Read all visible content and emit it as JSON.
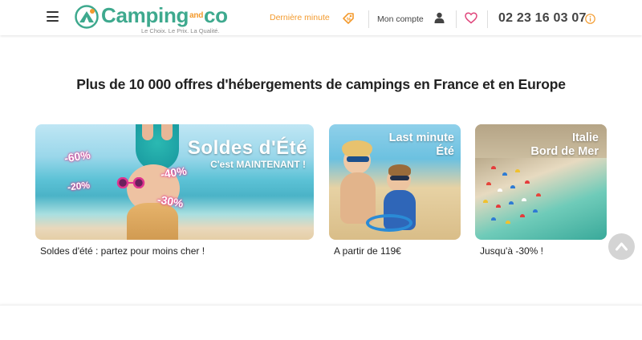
{
  "header": {
    "menu_icon": "hamburger-icon",
    "logo": {
      "name_part1": "Camping",
      "name_part2": "and",
      "name_part3": "co",
      "tagline": "Le Choix. Le Prix. La Qualité."
    },
    "last_minute_label": "Dernière minute",
    "last_minute_icon": "tag-icon",
    "account_label": "Mon compte",
    "account_icon": "user-icon",
    "wishlist_icon": "heart-icon",
    "phone": "02 23 16 03 07",
    "phone_info_icon": "info-icon",
    "colors": {
      "brand_green": "#3ea98e",
      "accent_orange": "#f39a2d",
      "heart_pink": "#e0457b"
    }
  },
  "main": {
    "headline": "Plus de 10 000 offres d'hébergements de campings en France et en Europe",
    "cards": [
      {
        "caption": "Soldes d'été : partez pour moins cher !",
        "banner_title": "Soldes d'Été",
        "banner_subtitle": "C'est MAINTENANT !",
        "badges": [
          "-60%",
          "-40%",
          "-20%",
          "-30%"
        ]
      },
      {
        "caption": "A partir de 119€",
        "banner_title_line1": "Last minute",
        "banner_title_line2": "Été"
      },
      {
        "caption": "Jusqu'à -30% !",
        "banner_title_line1": "Italie",
        "banner_title_line2": "Bord de Mer"
      }
    ]
  },
  "scroll_top_icon": "chevron-up-icon"
}
